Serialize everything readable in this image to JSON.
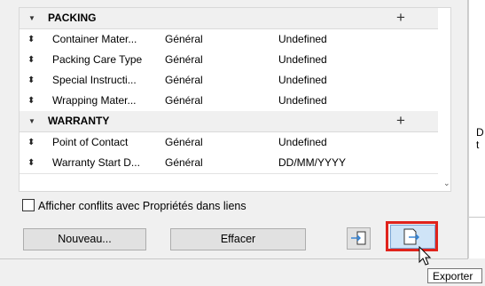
{
  "groups": [
    {
      "label": "PACKING",
      "rows": [
        {
          "name": "Container Mater...",
          "category": "Général",
          "value": "Undefined"
        },
        {
          "name": "Packing Care Type",
          "category": "Général",
          "value": "Undefined"
        },
        {
          "name": "Special Instructi...",
          "category": "Général",
          "value": "Undefined"
        },
        {
          "name": "Wrapping Mater...",
          "category": "Général",
          "value": "Undefined"
        }
      ]
    },
    {
      "label": "WARRANTY",
      "rows": [
        {
          "name": "Point of Contact",
          "category": "Général",
          "value": "Undefined"
        },
        {
          "name": "Warranty Start D...",
          "category": "Général",
          "value": "DD/MM/YYYY"
        }
      ]
    }
  ],
  "checkbox": {
    "label": "Afficher conflits avec Propriétés dans liens",
    "checked": false
  },
  "buttons": {
    "new_label": "Nouveau...",
    "delete_label": "Effacer"
  },
  "tooltip": {
    "text": "Exporter"
  },
  "right_pane": {
    "line1": "D",
    "line2": "t"
  },
  "colors": {
    "highlight": "#e0231c",
    "import_icon": "#2d7fd3"
  }
}
